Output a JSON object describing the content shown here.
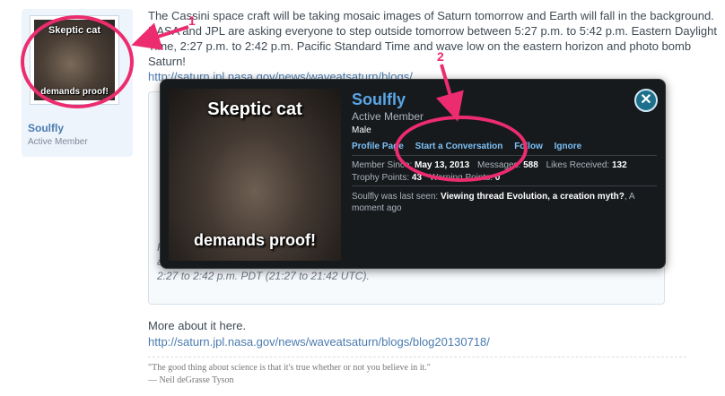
{
  "post": {
    "body": "The Cassini space craft will be taking mosaic images of Saturn tomorrow and Earth will fall in the background. NASA and JPL are asking everyone to step outside tomorrow between 5:27 p.m. to 5:42 p.m. Eastern Daylight Time, 2:27 p.m. to 2:42 p.m. Pacific Standard Time and wave low on the eastern horizon and photo bomb Saturn!",
    "link1": "http://saturn.jpl.nasa.gov/news/waveatsaturn/blogs/",
    "quote": "Find Saturn in your sky (or stay inside) and wave low on your eastern horizon at the same time (for U.S.) as Cassini's cameras take a series of pictures over about 15 minutes in the afternoon of July 19 from 2:27 to 2:42 p.m. PDT (21:27 to 21:42 UTC).",
    "more_label": "More about it here.",
    "more_link": "http://saturn.jpl.nasa.gov/news/waveatsaturn/blogs/blog20130718/",
    "signature_quote": "\"The good thing about science is that it's true whether or not you believe in it.\"",
    "signature_author": "— Neil deGrasse Tyson"
  },
  "author": {
    "name": "Soulfly",
    "title": "Active Member",
    "avatar_top": "Skeptic cat",
    "avatar_bottom": "demands proof!"
  },
  "popup": {
    "name": "Soulfly",
    "title": "Active Member",
    "gender": "Male",
    "links": {
      "profile": "Profile Page",
      "conversation": "Start a Conversation",
      "follow": "Follow",
      "ignore": "Ignore"
    },
    "stats": {
      "member_since_label": "Member Since:",
      "member_since": "May 13, 2013",
      "messages_label": "Messages:",
      "messages": "588",
      "likes_label": "Likes Received:",
      "likes": "132",
      "trophy_label": "Trophy Points:",
      "trophy": "43",
      "warnings_label": "Warning Points:",
      "warnings": "0"
    },
    "last_seen_prefix": "Soulfly was last seen:",
    "last_seen_thread": "Viewing thread Evolution, a creation myth?",
    "last_seen_time": ", A moment ago",
    "photo_top": "Skeptic cat",
    "photo_bottom": "demands proof!",
    "close_glyph": "✕"
  },
  "annotations": {
    "marker1": "1",
    "marker2": "2",
    "color": "#ec2c6e"
  }
}
